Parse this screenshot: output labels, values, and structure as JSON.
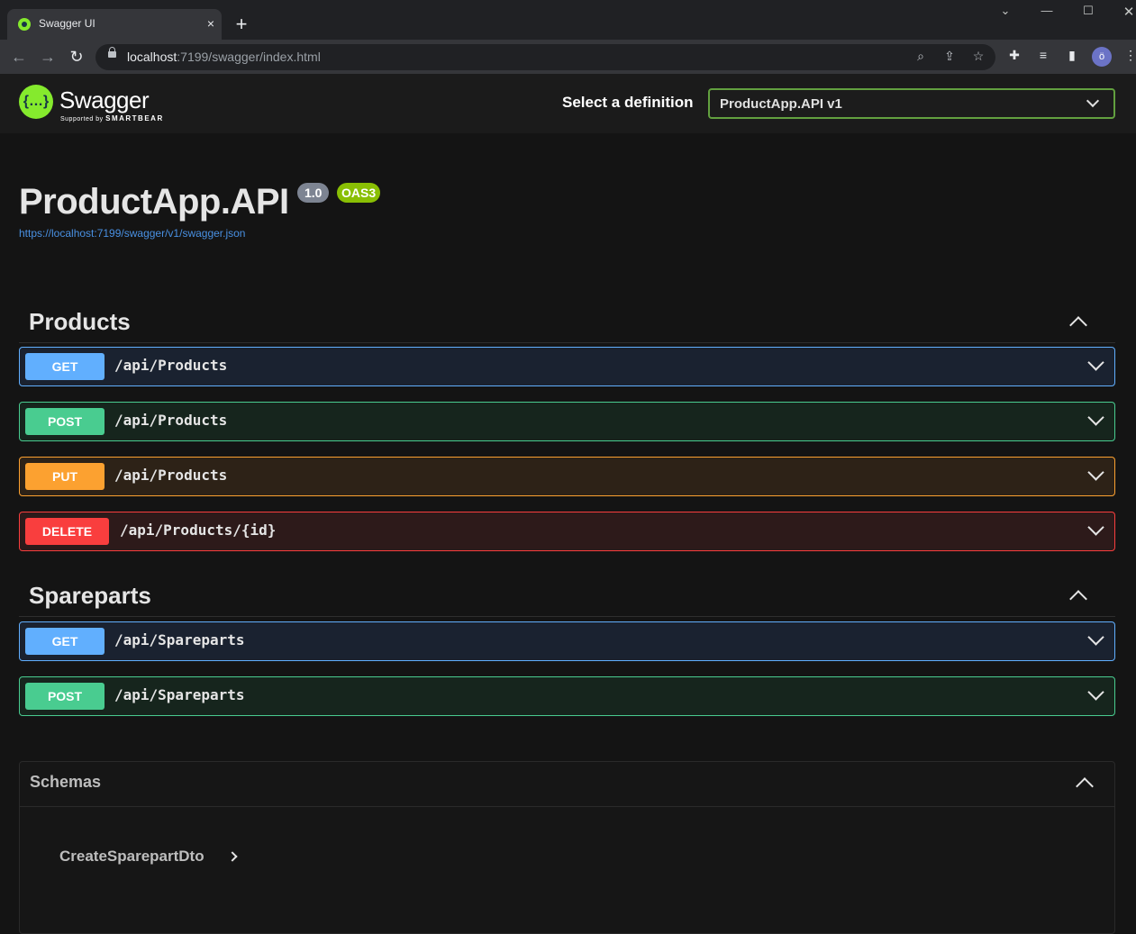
{
  "browser": {
    "tab_title": "Swagger UI",
    "tab_close": "×",
    "new_tab": "+",
    "url_host": "localhost",
    "url_rest": ":7199/swagger/index.html",
    "profile_initial": "ö"
  },
  "swagger": {
    "logo_text": "Swagger",
    "logo_sub": "Supported by",
    "logo_sub_brand": "SMARTBEAR",
    "definition_label": "Select a definition",
    "definition_value": "ProductApp.API v1"
  },
  "info": {
    "title": "ProductApp.API",
    "version": "1.0",
    "oas": "OAS3",
    "spec_url": "https://localhost:7199/swagger/v1/swagger.json"
  },
  "tags": [
    {
      "name": "Products",
      "operations": [
        {
          "method": "GET",
          "path": "/api/Products"
        },
        {
          "method": "POST",
          "path": "/api/Products"
        },
        {
          "method": "PUT",
          "path": "/api/Products"
        },
        {
          "method": "DELETE",
          "path": "/api/Products/{id}"
        }
      ]
    },
    {
      "name": "Spareparts",
      "operations": [
        {
          "method": "GET",
          "path": "/api/Spareparts"
        },
        {
          "method": "POST",
          "path": "/api/Spareparts"
        }
      ]
    }
  ],
  "schemas": {
    "title": "Schemas",
    "models": [
      "CreateSparepartDto"
    ]
  },
  "colors": {
    "get": "#61affe",
    "post": "#49cc90",
    "put": "#fca130",
    "delete": "#f93e3e",
    "swagger_green": "#85ea2d"
  }
}
